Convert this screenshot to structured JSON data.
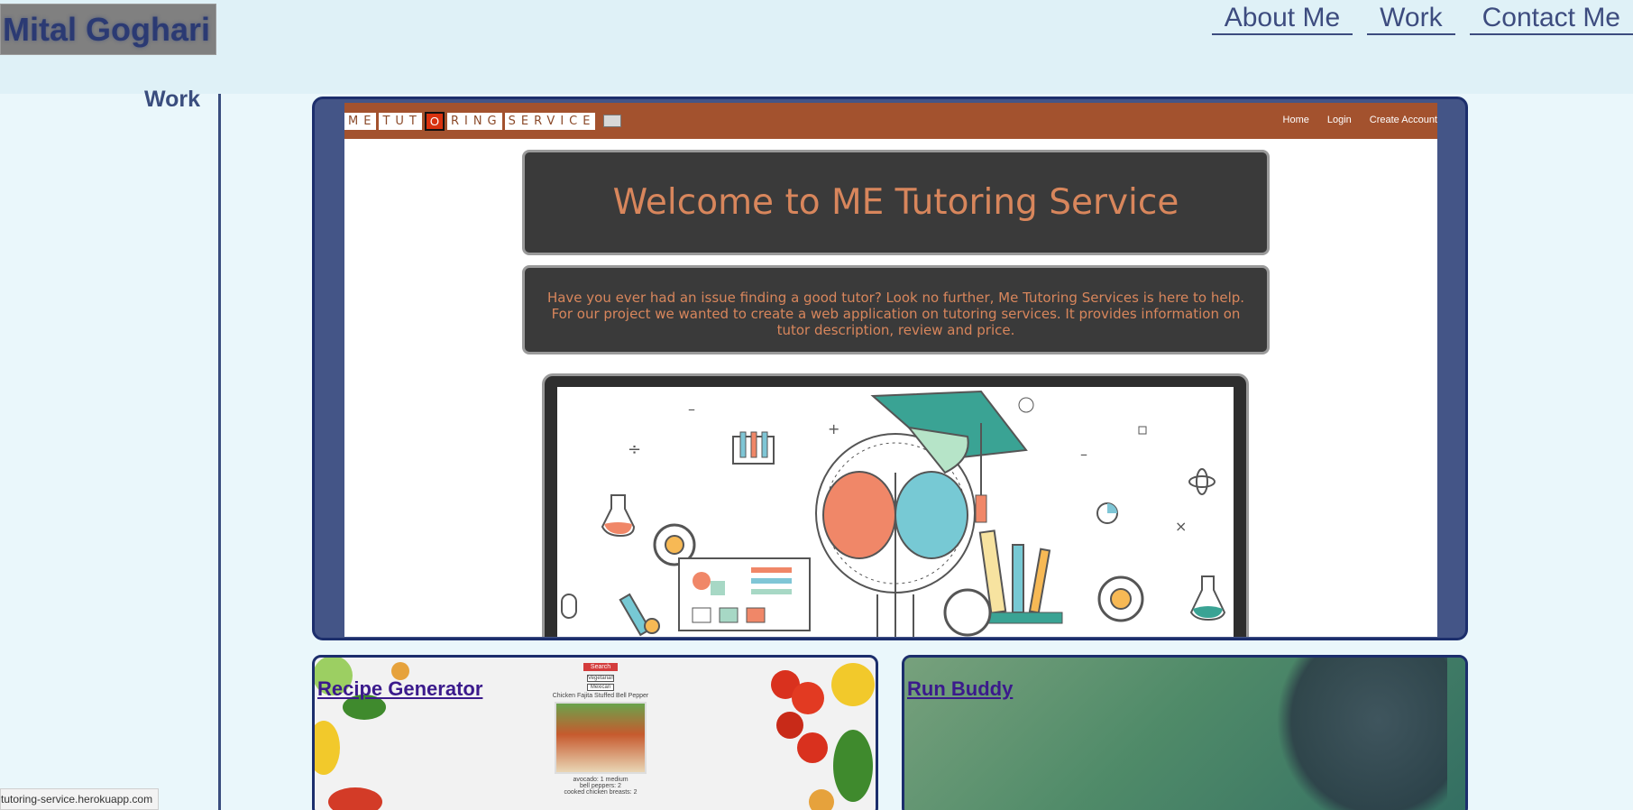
{
  "header": {
    "brand": "Mital Goghari",
    "nav": [
      "About Me",
      "Work",
      "Contact Me"
    ]
  },
  "sidebar": {
    "section_label": "Work"
  },
  "featured": {
    "site": {
      "logo_left": "ME",
      "logo_mid_a": "TUT",
      "logo_o": "O",
      "logo_mid_b": "RING",
      "logo_right": "SERVICE",
      "links": [
        "Home",
        "Login",
        "Create Account"
      ],
      "title": "Welcome to ME Tutoring Service",
      "description": "Have you ever had an issue finding a good tutor? Look no further, Me Tutoring Services is here to help. For our project we wanted to create a web application on tutoring services. It provides information on tutor description, review and price."
    }
  },
  "projects": [
    {
      "title": "Recipe Generator",
      "preview": {
        "search": "Search",
        "btn_a": "Vegetarian",
        "btn_b": "Mexican",
        "dish": "Chicken Fajita Stuffed Bell Pepper",
        "ing_1": "avocado: 1 medium",
        "ing_2": "bell peppers: 2",
        "ing_3": "cooked chicken breasts: 2"
      }
    },
    {
      "title": "Run Buddy"
    }
  ],
  "status_bar": {
    "url": "tutoring-service.herokuapp.com"
  },
  "colors": {
    "accent": "#3a4d7e",
    "card_border": "#1c2e6c",
    "site_nav": "#a3522e",
    "title_text": "#d8865c"
  }
}
